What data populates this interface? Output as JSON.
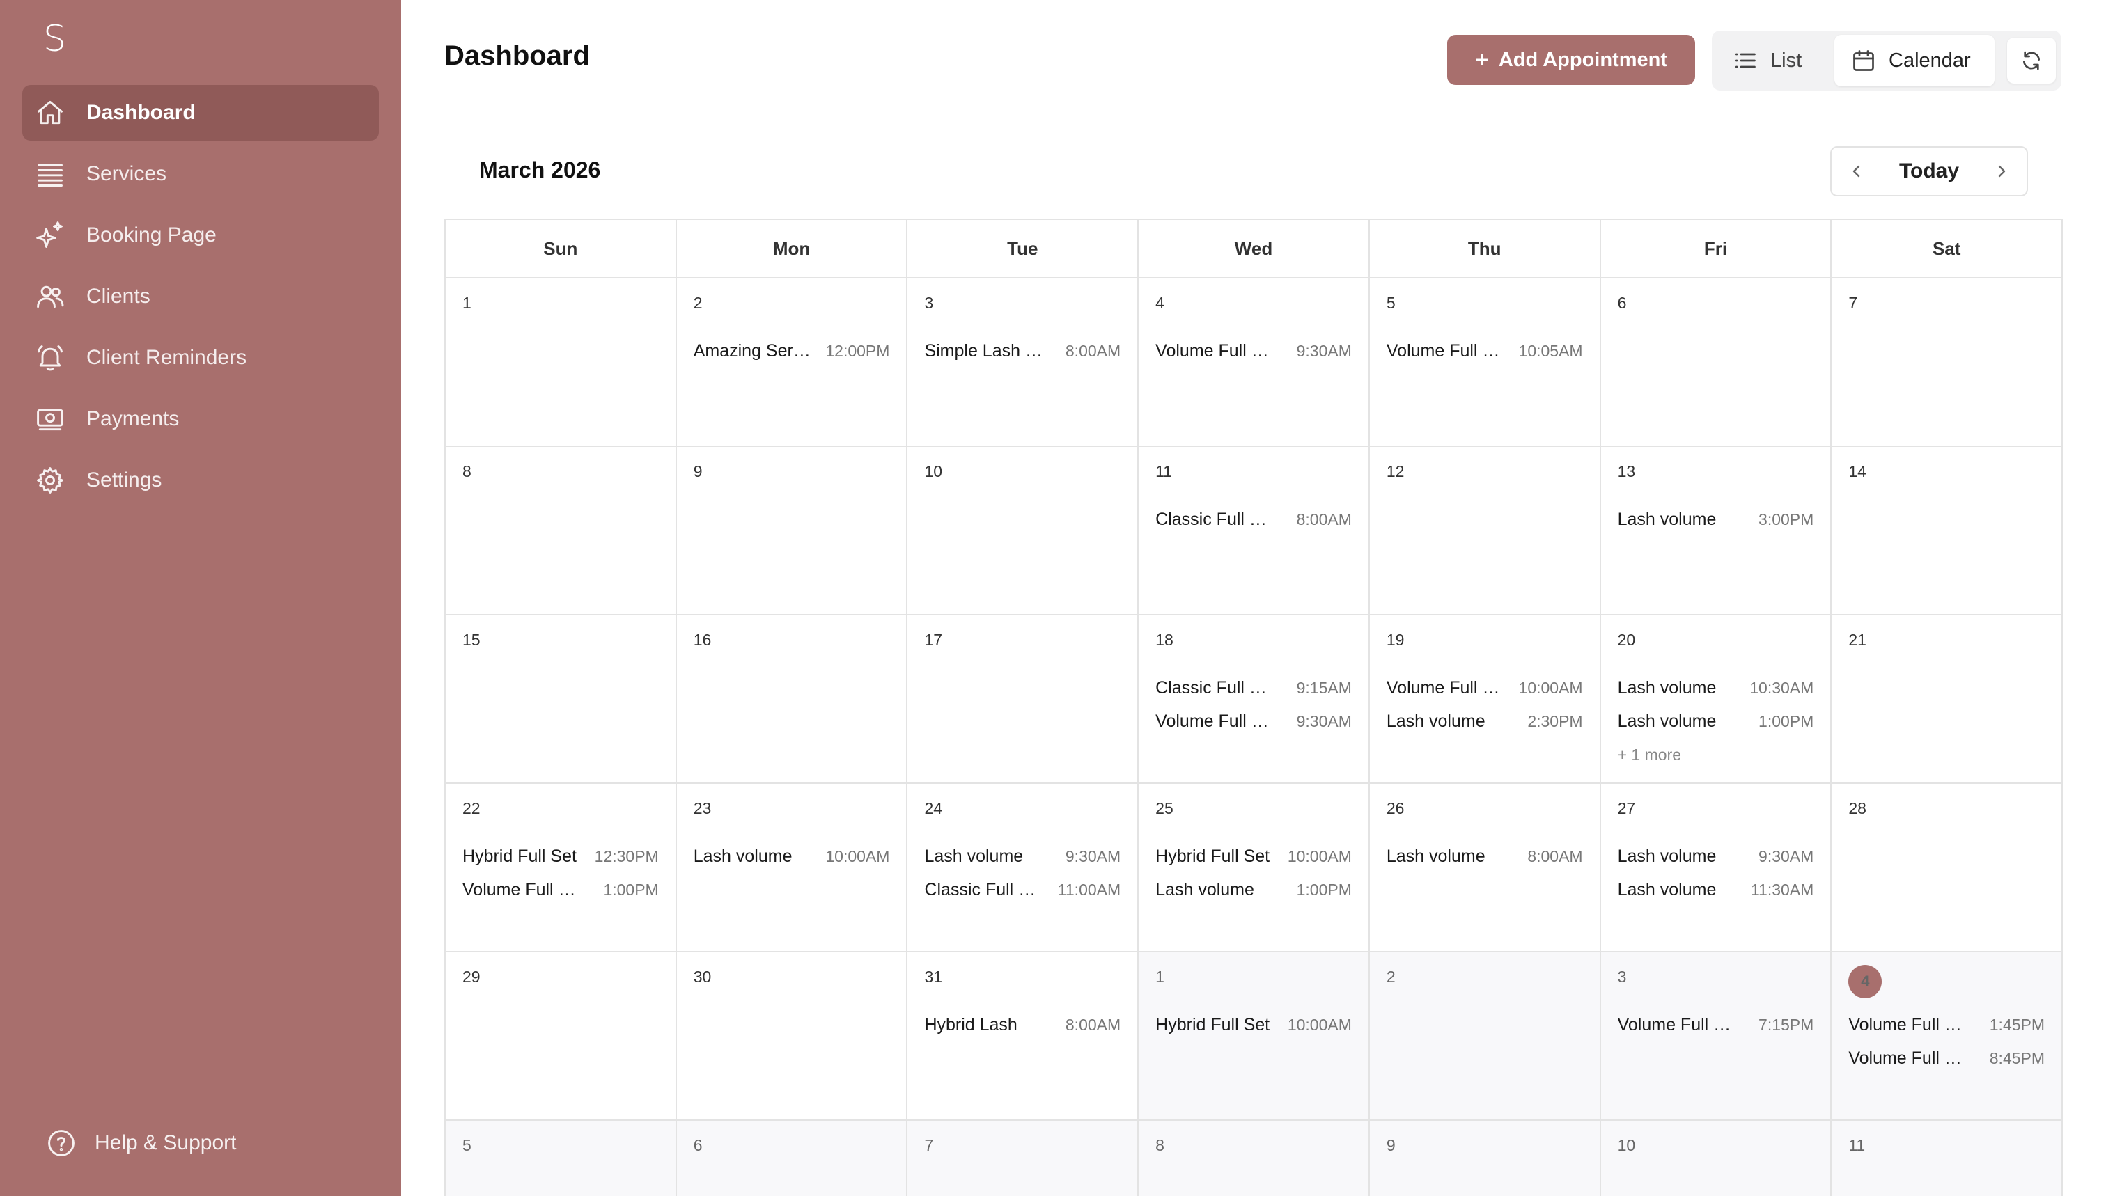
{
  "app": {
    "logo_letter": "S"
  },
  "sidebar": {
    "items": [
      {
        "label": "Dashboard",
        "icon": "home-icon"
      },
      {
        "label": "Services",
        "icon": "list-stack-icon"
      },
      {
        "label": "Booking Page",
        "icon": "sparkles-icon"
      },
      {
        "label": "Clients",
        "icon": "users-icon"
      },
      {
        "label": "Client Reminders",
        "icon": "bell-icon"
      },
      {
        "label": "Payments",
        "icon": "cash-icon"
      },
      {
        "label": "Settings",
        "icon": "gear-icon"
      }
    ],
    "help_label": "Help & Support"
  },
  "header": {
    "title": "Dashboard",
    "add_label": "Add Appointment",
    "list_label": "List",
    "calendar_label": "Calendar"
  },
  "calendar": {
    "month_label": "March 2026",
    "today_label": "Today",
    "weekdays": [
      "Sun",
      "Mon",
      "Tue",
      "Wed",
      "Thu",
      "Fri",
      "Sat"
    ],
    "weeks": [
      [
        {
          "d": "1",
          "ev": []
        },
        {
          "d": "2",
          "ev": [
            [
              "Amazing Service",
              "12:00PM"
            ]
          ]
        },
        {
          "d": "3",
          "ev": [
            [
              "Simple Lash Lift",
              "8:00AM"
            ]
          ]
        },
        {
          "d": "4",
          "ev": [
            [
              "Volume Full Set",
              "9:30AM"
            ]
          ]
        },
        {
          "d": "5",
          "ev": [
            [
              "Volume Full Set",
              "10:05AM"
            ]
          ]
        },
        {
          "d": "6",
          "ev": []
        },
        {
          "d": "7",
          "ev": []
        }
      ],
      [
        {
          "d": "8",
          "ev": []
        },
        {
          "d": "9",
          "ev": []
        },
        {
          "d": "10",
          "ev": []
        },
        {
          "d": "11",
          "ev": [
            [
              "Classic Full Set",
              "8:00AM"
            ]
          ]
        },
        {
          "d": "12",
          "ev": []
        },
        {
          "d": "13",
          "ev": [
            [
              "Lash volume",
              "3:00PM"
            ]
          ]
        },
        {
          "d": "14",
          "ev": []
        }
      ],
      [
        {
          "d": "15",
          "ev": []
        },
        {
          "d": "16",
          "ev": []
        },
        {
          "d": "17",
          "ev": []
        },
        {
          "d": "18",
          "ev": [
            [
              "Classic Full Set",
              "9:15AM"
            ],
            [
              "Volume Full Set",
              "9:30AM"
            ]
          ]
        },
        {
          "d": "19",
          "ev": [
            [
              "Volume Full Set",
              "10:00AM"
            ],
            [
              "Lash volume",
              "2:30PM"
            ]
          ]
        },
        {
          "d": "20",
          "ev": [
            [
              "Lash volume",
              "10:30AM"
            ],
            [
              "Lash volume",
              "1:00PM"
            ]
          ],
          "more": "+ 1 more"
        },
        {
          "d": "21",
          "ev": []
        }
      ],
      [
        {
          "d": "22",
          "ev": [
            [
              "Hybrid Full Set",
              "12:30PM"
            ],
            [
              "Volume Full Set",
              "1:00PM"
            ]
          ]
        },
        {
          "d": "23",
          "ev": [
            [
              "Lash volume",
              "10:00AM"
            ]
          ]
        },
        {
          "d": "24",
          "ev": [
            [
              "Lash volume",
              "9:30AM"
            ],
            [
              "Classic Full Set",
              "11:00AM"
            ]
          ]
        },
        {
          "d": "25",
          "ev": [
            [
              "Hybrid Full Set",
              "10:00AM"
            ],
            [
              "Lash volume",
              "1:00PM"
            ]
          ]
        },
        {
          "d": "26",
          "ev": [
            [
              "Lash volume",
              "8:00AM"
            ]
          ]
        },
        {
          "d": "27",
          "ev": [
            [
              "Lash volume",
              "9:30AM"
            ],
            [
              "Lash volume",
              "11:30AM"
            ]
          ]
        },
        {
          "d": "28",
          "ev": []
        }
      ],
      [
        {
          "d": "29",
          "ev": []
        },
        {
          "d": "30",
          "ev": []
        },
        {
          "d": "31",
          "ev": [
            [
              "Hybrid Lash",
              "8:00AM"
            ]
          ]
        },
        {
          "d": "1",
          "other": true,
          "ev": [
            [
              "Hybrid Full Set",
              "10:00AM"
            ]
          ]
        },
        {
          "d": "2",
          "other": true,
          "ev": []
        },
        {
          "d": "3",
          "other": true,
          "ev": [
            [
              "Volume Full Set",
              "7:15PM"
            ]
          ]
        },
        {
          "d": "4",
          "other": true,
          "today": true,
          "ev": [
            [
              "Volume Full Set",
              "1:45PM"
            ],
            [
              "Volume Full Set",
              "8:45PM"
            ]
          ]
        }
      ],
      [
        {
          "d": "5",
          "other": true,
          "ev": []
        },
        {
          "d": "6",
          "other": true,
          "ev": []
        },
        {
          "d": "7",
          "other": true,
          "ev": []
        },
        {
          "d": "8",
          "other": true,
          "ev": []
        },
        {
          "d": "9",
          "other": true,
          "ev": []
        },
        {
          "d": "10",
          "other": true,
          "ev": []
        },
        {
          "d": "11",
          "other": true,
          "ev": []
        }
      ]
    ]
  },
  "colors": {
    "brand": "#a86f6d",
    "brand_dark": "#905a58"
  }
}
